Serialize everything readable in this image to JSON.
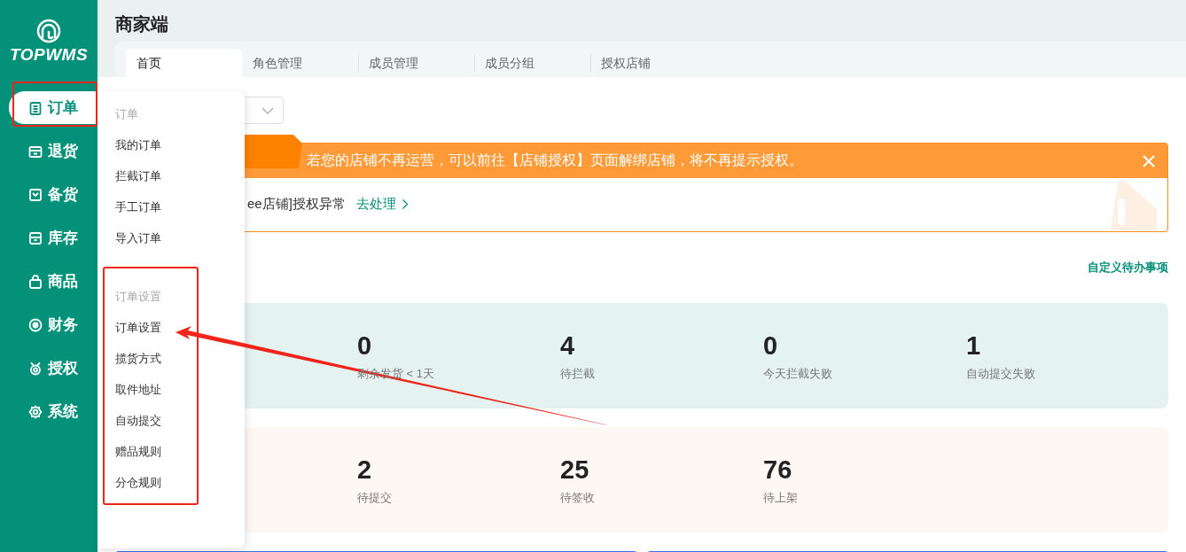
{
  "logo": {
    "text": "TOPWMS"
  },
  "sidebar": {
    "items": [
      {
        "label": "订单",
        "selected": true
      },
      {
        "label": "退货",
        "selected": false
      },
      {
        "label": "备货",
        "selected": false
      },
      {
        "label": "库存",
        "selected": false
      },
      {
        "label": "商品",
        "selected": false
      },
      {
        "label": "财务",
        "selected": false
      },
      {
        "label": "授权",
        "selected": false
      },
      {
        "label": "系统",
        "selected": false
      }
    ]
  },
  "header": {
    "title": "商家端"
  },
  "tabs": [
    {
      "label": "首页",
      "selected": true
    },
    {
      "label": "角色管理",
      "selected": false
    },
    {
      "label": "成员管理",
      "selected": false
    },
    {
      "label": "成员分组",
      "selected": false
    },
    {
      "label": "授权店铺",
      "selected": false
    }
  ],
  "banner": {
    "message": "若您的店铺不再运营，可以前往【店铺授权】页面解绑店铺，将不再提示授权。",
    "alert": "ee店铺]授权异常",
    "action": "去处理"
  },
  "todo_link": "自定义待办事项",
  "stat_groups": [
    {
      "color": "#e5f3f0",
      "stats": [
        {
          "value": "0",
          "label": "剩余发货 < 1天"
        },
        {
          "value": "4",
          "label": "待拦截"
        },
        {
          "value": "0",
          "label": "今天拦截失败"
        },
        {
          "value": "1",
          "label": "自动提交失败"
        }
      ]
    },
    {
      "color": "#fef8f4",
      "stats": [
        {
          "value": "2",
          "label": "待提交"
        },
        {
          "value": "25",
          "label": "待签收"
        },
        {
          "value": "76",
          "label": "待上架"
        }
      ]
    }
  ],
  "menu": {
    "groups": [
      {
        "heading": "订单",
        "items": [
          "我的订单",
          "拦截订单",
          "手工订单",
          "导入订单"
        ]
      },
      {
        "heading": "订单设置",
        "items": [
          "订单设置",
          "揽货方式",
          "取件地址",
          "自动提交",
          "赠品规则",
          "分仓规则"
        ]
      }
    ]
  }
}
